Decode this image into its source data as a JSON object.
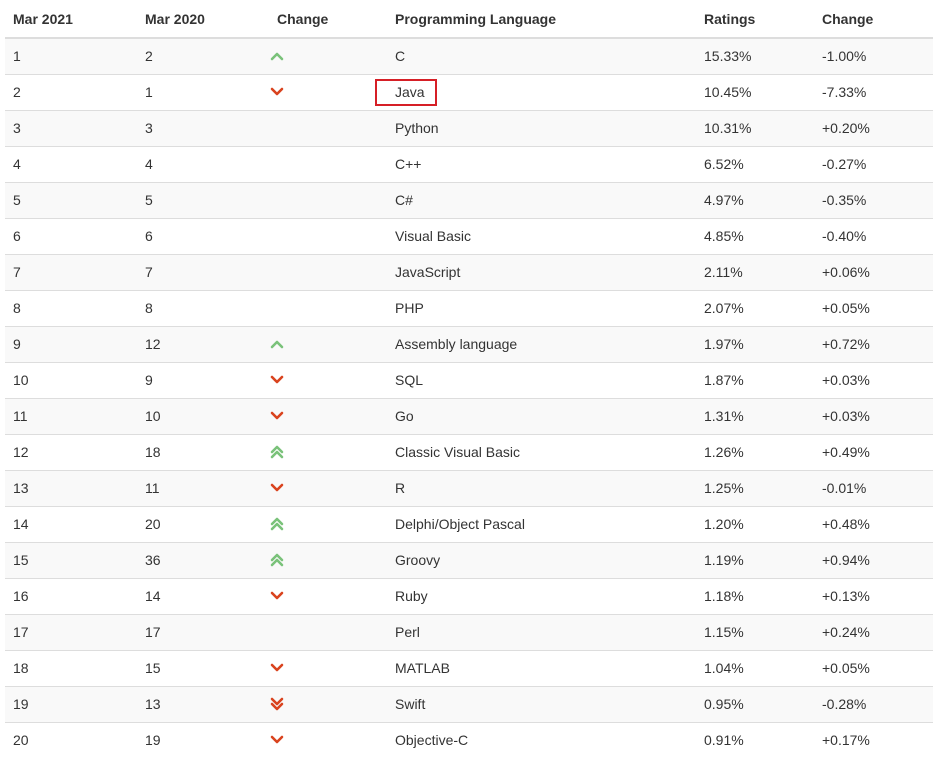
{
  "table": {
    "headers": [
      "Mar 2021",
      "Mar 2020",
      "Change",
      "Programming Language",
      "Ratings",
      "Change"
    ],
    "rows": [
      {
        "rank": "1",
        "prev": "2",
        "trend": "up",
        "lang": "C",
        "rating": "15.33%",
        "change": "-1.00%"
      },
      {
        "rank": "2",
        "prev": "1",
        "trend": "down",
        "lang": "Java",
        "rating": "10.45%",
        "change": "-7.33%"
      },
      {
        "rank": "3",
        "prev": "3",
        "trend": "none",
        "lang": "Python",
        "rating": "10.31%",
        "change": "+0.20%"
      },
      {
        "rank": "4",
        "prev": "4",
        "trend": "none",
        "lang": "C++",
        "rating": "6.52%",
        "change": "-0.27%"
      },
      {
        "rank": "5",
        "prev": "5",
        "trend": "none",
        "lang": "C#",
        "rating": "4.97%",
        "change": "-0.35%"
      },
      {
        "rank": "6",
        "prev": "6",
        "trend": "none",
        "lang": "Visual Basic",
        "rating": "4.85%",
        "change": "-0.40%"
      },
      {
        "rank": "7",
        "prev": "7",
        "trend": "none",
        "lang": "JavaScript",
        "rating": "2.11%",
        "change": "+0.06%"
      },
      {
        "rank": "8",
        "prev": "8",
        "trend": "none",
        "lang": "PHP",
        "rating": "2.07%",
        "change": "+0.05%"
      },
      {
        "rank": "9",
        "prev": "12",
        "trend": "up",
        "lang": "Assembly language",
        "rating": "1.97%",
        "change": "+0.72%"
      },
      {
        "rank": "10",
        "prev": "9",
        "trend": "down",
        "lang": "SQL",
        "rating": "1.87%",
        "change": "+0.03%"
      },
      {
        "rank": "11",
        "prev": "10",
        "trend": "down",
        "lang": "Go",
        "rating": "1.31%",
        "change": "+0.03%"
      },
      {
        "rank": "12",
        "prev": "18",
        "trend": "double-up",
        "lang": "Classic Visual Basic",
        "rating": "1.26%",
        "change": "+0.49%"
      },
      {
        "rank": "13",
        "prev": "11",
        "trend": "down",
        "lang": "R",
        "rating": "1.25%",
        "change": "-0.01%"
      },
      {
        "rank": "14",
        "prev": "20",
        "trend": "double-up",
        "lang": "Delphi/Object Pascal",
        "rating": "1.20%",
        "change": "+0.48%"
      },
      {
        "rank": "15",
        "prev": "36",
        "trend": "double-up",
        "lang": "Groovy",
        "rating": "1.19%",
        "change": "+0.94%"
      },
      {
        "rank": "16",
        "prev": "14",
        "trend": "down",
        "lang": "Ruby",
        "rating": "1.18%",
        "change": "+0.13%"
      },
      {
        "rank": "17",
        "prev": "17",
        "trend": "none",
        "lang": "Perl",
        "rating": "1.15%",
        "change": "+0.24%"
      },
      {
        "rank": "18",
        "prev": "15",
        "trend": "down",
        "lang": "MATLAB",
        "rating": "1.04%",
        "change": "+0.05%"
      },
      {
        "rank": "19",
        "prev": "13",
        "trend": "double-down",
        "lang": "Swift",
        "rating": "0.95%",
        "change": "-0.28%"
      },
      {
        "rank": "20",
        "prev": "19",
        "trend": "down",
        "lang": "Objective-C",
        "rating": "0.91%",
        "change": "+0.17%"
      }
    ],
    "highlighted_language": "Java"
  },
  "colors": {
    "up": "#7ac27a",
    "down": "#d9431e",
    "highlight": "#d61f26",
    "border": "#dddddd",
    "stripe": "#f9f9f9"
  },
  "icons": {
    "up": "chevron-up-icon",
    "double-up": "double-chevron-up-icon",
    "down": "chevron-down-icon",
    "double-down": "double-chevron-down-icon"
  }
}
